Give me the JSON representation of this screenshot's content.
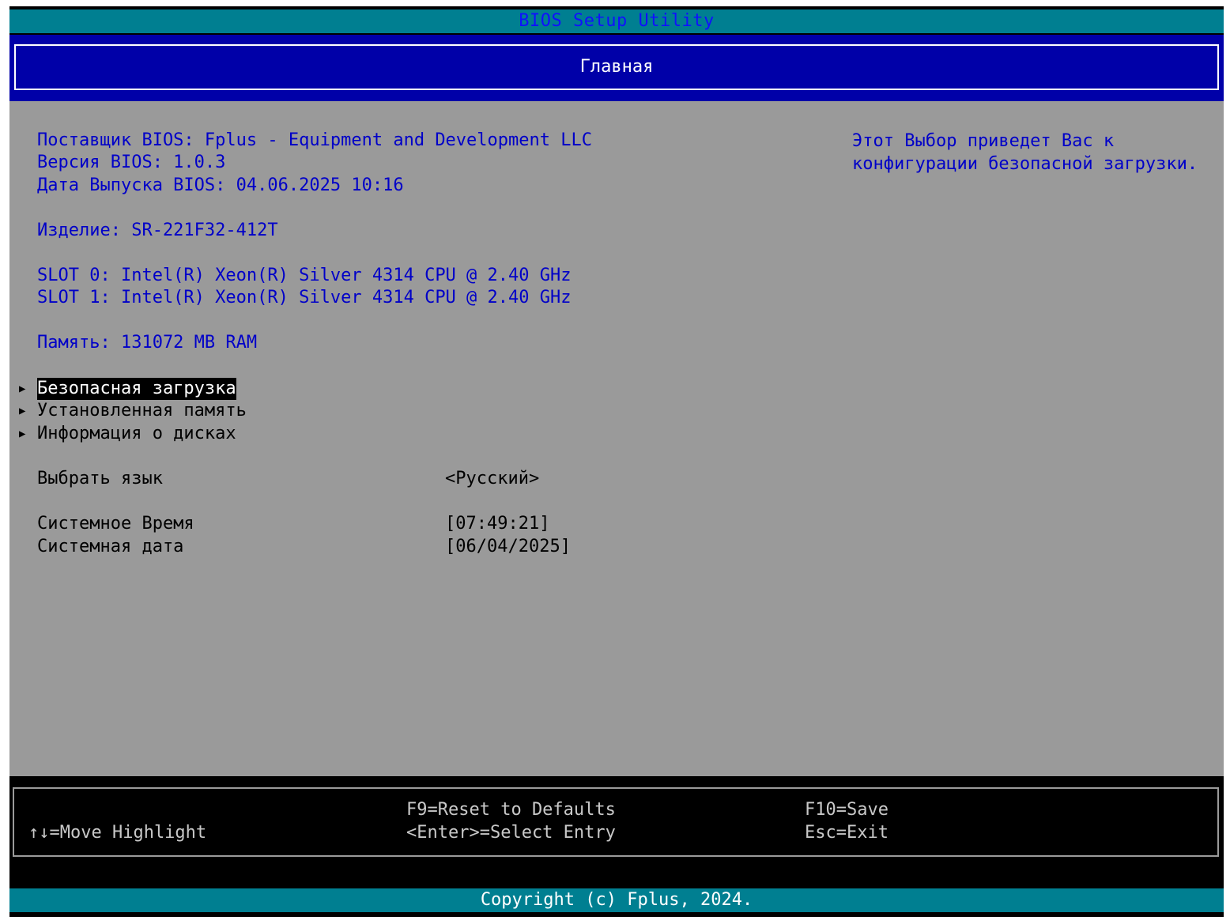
{
  "window": {
    "title": "BIOS Setup Utility"
  },
  "tabs": {
    "active": "Главная"
  },
  "info": {
    "vendor": "Поставщик BIOS: Fplus - Equipment and Development LLC",
    "version": "Версия BIOS: 1.0.3",
    "release_date": "Дата Выпуска BIOS: 04.06.2025 10:16",
    "product": "Изделие: SR-221F32-412T",
    "slot0": "SLOT 0: Intel(R) Xeon(R) Silver 4314 CPU @ 2.40 GHz",
    "slot1": "SLOT 1: Intel(R) Xeon(R) Silver 4314 CPU @ 2.40 GHz",
    "memory": "Память: 131072 MB RAM"
  },
  "menu": {
    "items": [
      {
        "label": "Безопасная загрузка",
        "selected": true
      },
      {
        "label": "Установленная память",
        "selected": false
      },
      {
        "label": "Информация о дисках",
        "selected": false
      }
    ],
    "arrow_icon": "right-triangle-icon"
  },
  "settings": {
    "language_label": "Выбрать язык",
    "language_value": "<Русский>",
    "time_label": "Системное Время",
    "time_value": "[07:49:21]",
    "date_label": "Системная дата",
    "date_value": "[06/04/2025]"
  },
  "help": {
    "text": "Этот Выбор приведет Вас к\nконфигурации безопасной загрузки."
  },
  "footer": {
    "move_highlight": "↑↓=Move Highlight",
    "reset_defaults": "F9=Reset to Defaults",
    "select_entry": "<Enter>=Select Entry",
    "save": "F10=Save",
    "exit": "Esc=Exit",
    "copyright": "Copyright (c) Fplus, 2024."
  },
  "colors": {
    "title_bar": "#007f91",
    "tab_bar": "#0000a8",
    "content_bg": "#9a9a9a",
    "info_text": "#0000c8"
  }
}
